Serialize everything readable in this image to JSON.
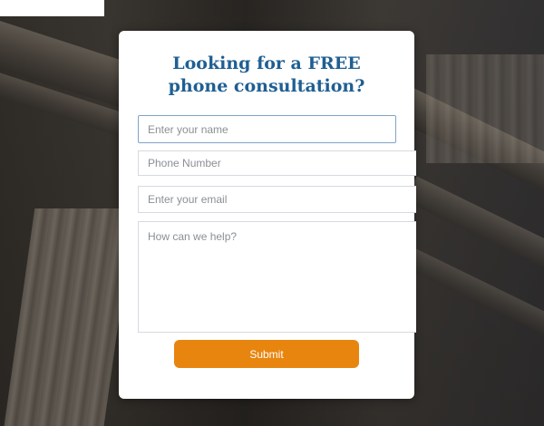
{
  "form": {
    "heading_line1": "Looking for a FREE",
    "heading_line2": "phone consultation?",
    "name_placeholder": "Enter your name",
    "phone_placeholder": "Phone Number",
    "email_placeholder": "Enter your email",
    "message_placeholder": "How can we help?",
    "submit_label": "Submit"
  },
  "colors": {
    "heading": "#1f5f93",
    "submit_button": "#e8850f",
    "card_background": "#ffffff"
  }
}
